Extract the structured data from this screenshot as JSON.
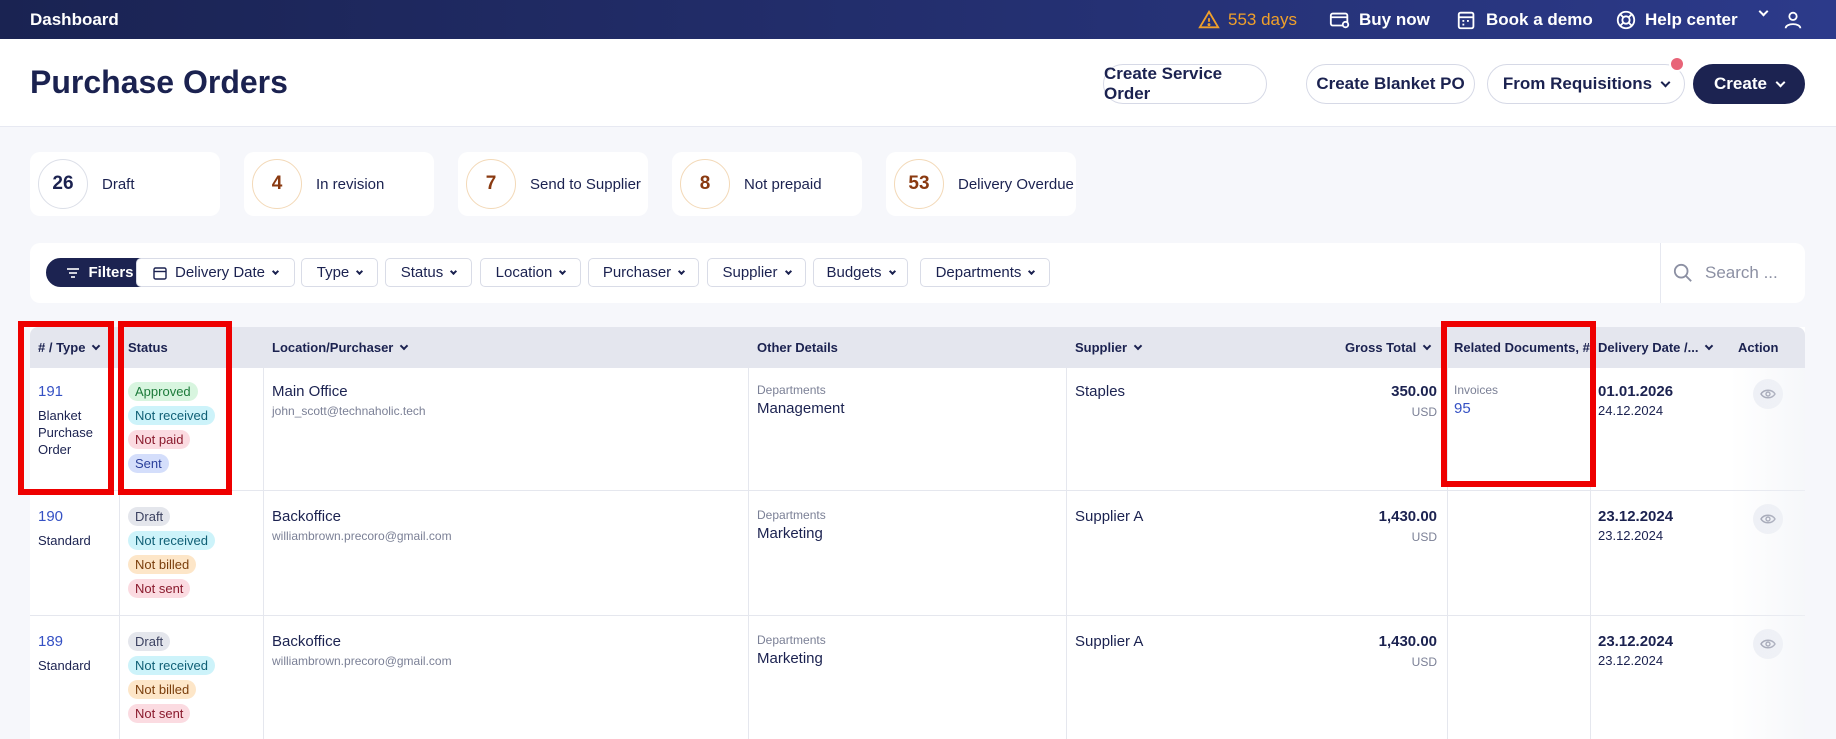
{
  "topbar": {
    "brand": "Dashboard",
    "trial": "553 days",
    "buy_now": "Buy now",
    "book_demo": "Book a demo",
    "help_center": "Help center"
  },
  "header": {
    "title": "Purchase Orders",
    "create_service_order": "Create Service Order",
    "create_blanket_po": "Create Blanket PO",
    "from_requisitions": "From Requisitions",
    "create": "Create"
  },
  "summary": [
    {
      "count": "26",
      "label": "Draft"
    },
    {
      "count": "4",
      "label": "In revision"
    },
    {
      "count": "7",
      "label": "Send to Supplier"
    },
    {
      "count": "8",
      "label": "Not prepaid"
    },
    {
      "count": "53",
      "label": "Delivery Overdue"
    }
  ],
  "filters": {
    "filters_label": "Filters",
    "chips": [
      "Delivery Date",
      "Type",
      "Status",
      "Location",
      "Purchaser",
      "Supplier",
      "Budgets",
      "Departments"
    ],
    "search_placeholder": "Search ..."
  },
  "table": {
    "columns": [
      "# / Type",
      "Status",
      "Location/Purchaser",
      "Other Details",
      "Supplier",
      "Gross Total",
      "Related Documents, #",
      "Delivery Date /...",
      "Action"
    ],
    "rows": [
      {
        "number": "191",
        "type": "Blanket Purchase Order",
        "statuses": [
          "Approved",
          "Not received",
          "Not paid",
          "Sent"
        ],
        "location": "Main Office",
        "purchaser": "john_scott@technaholic.tech",
        "details_label": "Departments",
        "details_value": "Management",
        "supplier": "Staples",
        "total": "350.00",
        "currency": "USD",
        "related_label": "Invoices",
        "related_value": "95",
        "delivery_date": "01.01.2026",
        "created_date": "24.12.2024"
      },
      {
        "number": "190",
        "type": "Standard",
        "statuses": [
          "Draft",
          "Not received",
          "Not billed",
          "Not sent"
        ],
        "location": "Backoffice",
        "purchaser": "williambrown.precoro@gmail.com",
        "details_label": "Departments",
        "details_value": "Marketing",
        "supplier": "Supplier A",
        "total": "1,430.00",
        "currency": "USD",
        "delivery_date": "23.12.2024",
        "created_date": "23.12.2024"
      },
      {
        "number": "189",
        "type": "Standard",
        "statuses": [
          "Draft",
          "Not received",
          "Not billed",
          "Not sent"
        ],
        "location": "Backoffice",
        "purchaser": "williambrown.precoro@gmail.com",
        "details_label": "Departments",
        "details_value": "Marketing",
        "supplier": "Supplier A",
        "total": "1,430.00",
        "currency": "USD",
        "delivery_date": "23.12.2024",
        "created_date": "23.12.2024"
      }
    ]
  },
  "colors": {
    "navy": "#1c2351",
    "accent_link": "#3551c4",
    "warning": "#f0a02a",
    "highlight": "#ee0000"
  }
}
